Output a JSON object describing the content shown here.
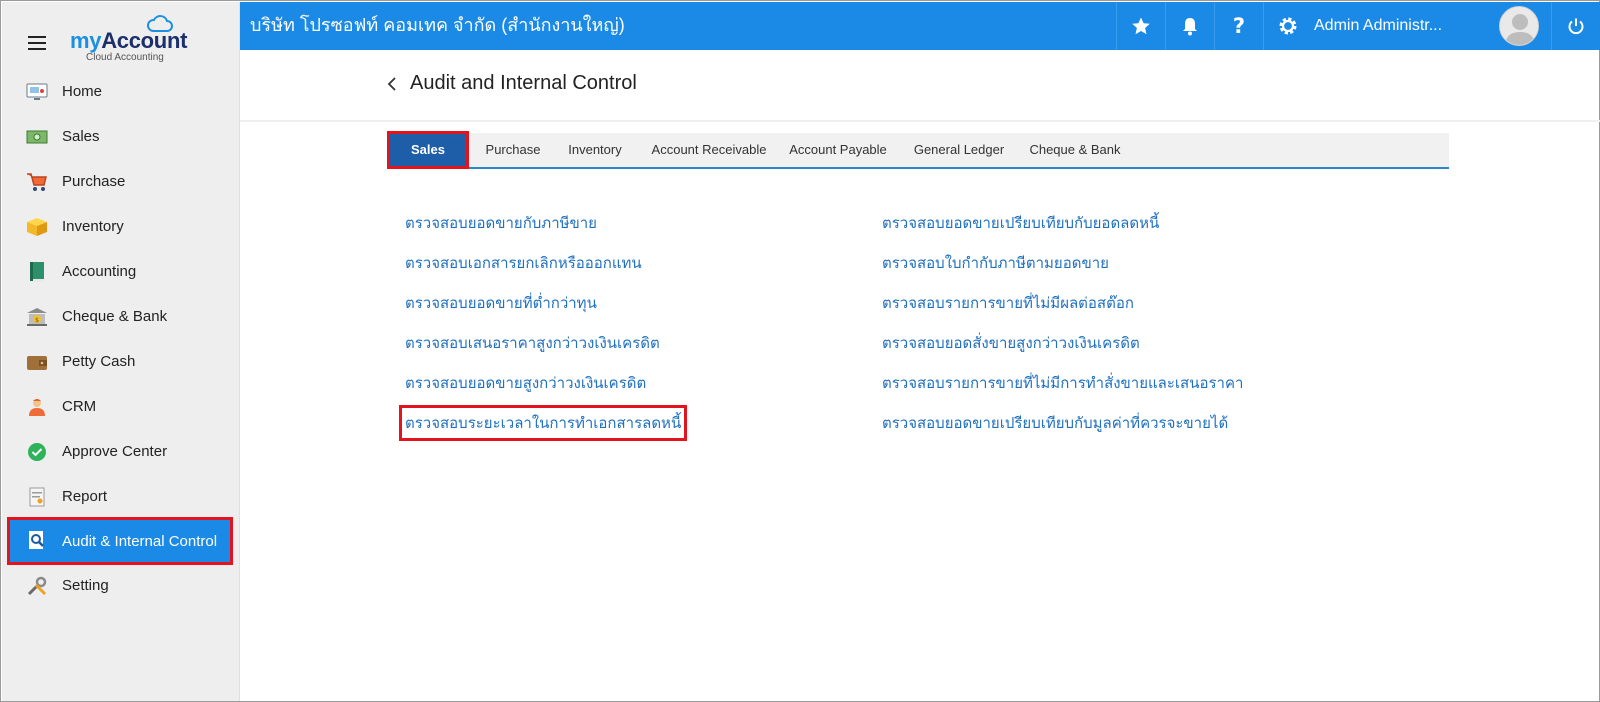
{
  "brand": {
    "name_my": "my",
    "name_account": "Account",
    "subtitle": "Cloud Accounting"
  },
  "sidebar": {
    "items": [
      {
        "label": "Home",
        "icon": "home-monitor-icon"
      },
      {
        "label": "Sales",
        "icon": "cash-icon"
      },
      {
        "label": "Purchase",
        "icon": "cart-icon"
      },
      {
        "label": "Inventory",
        "icon": "box-icon"
      },
      {
        "label": "Accounting",
        "icon": "ledger-book-icon"
      },
      {
        "label": "Cheque & Bank",
        "icon": "bank-icon"
      },
      {
        "label": "Petty Cash",
        "icon": "wallet-icon"
      },
      {
        "label": "CRM",
        "icon": "people-icon"
      },
      {
        "label": "Approve Center",
        "icon": "check-circle-icon"
      },
      {
        "label": "Report",
        "icon": "report-icon"
      },
      {
        "label": "Audit & Internal Control",
        "icon": "audit-magnifier-icon",
        "active": true
      },
      {
        "label": "Setting",
        "icon": "wrench-icon"
      }
    ]
  },
  "topbar": {
    "company": "บริษัท โปรซอฟท์ คอมเทค จำกัด (สำนักงานใหญ่)",
    "user": "Admin Administr...",
    "icons": [
      "star-icon",
      "bell-icon",
      "help-icon",
      "gear-icon",
      "power-icon"
    ]
  },
  "page": {
    "title": "Audit and Internal Control"
  },
  "tabs": [
    {
      "label": "Sales",
      "active": true
    },
    {
      "label": "Purchase"
    },
    {
      "label": "Inventory"
    },
    {
      "label": "Account Receivable"
    },
    {
      "label": "Account Payable"
    },
    {
      "label": "General Ledger"
    },
    {
      "label": "Cheque & Bank"
    }
  ],
  "links": {
    "left": [
      "ตรวจสอบยอดขายกับภาษีขาย",
      "ตรวจสอบเอกสารยกเลิกหรือออกแทน",
      "ตรวจสอบยอดขายที่ต่ำกว่าทุน",
      "ตรวจสอบเสนอราคาสูงกว่าวงเงินเครดิต",
      "ตรวจสอบยอดขายสูงกว่าวงเงินเครดิต",
      "ตรวจสอบระยะเวลาในการทำเอกสารลดหนี้"
    ],
    "right": [
      "ตรวจสอบยอดขายเปรียบเทียบกับยอดลดหนี้",
      "ตรวจสอบใบกำกับภาษีตามยอดขาย",
      "ตรวจสอบรายการขายที่ไม่มีผลต่อสต๊อก",
      "ตรวจสอบยอดสั่งขายสูงกว่าวงเงินเครดิต",
      "ตรวจสอบรายการขายที่ไม่มีการทำสั่งขายและเสนอราคา",
      "ตรวจสอบยอดขายเปรียบเทียบกับมูลค่าที่ควรจะขายได้"
    ]
  },
  "colors": {
    "primary": "#1a8ae6",
    "tab_active": "#1e5ea8",
    "highlight": "#e3141e",
    "link": "#2070c0"
  }
}
